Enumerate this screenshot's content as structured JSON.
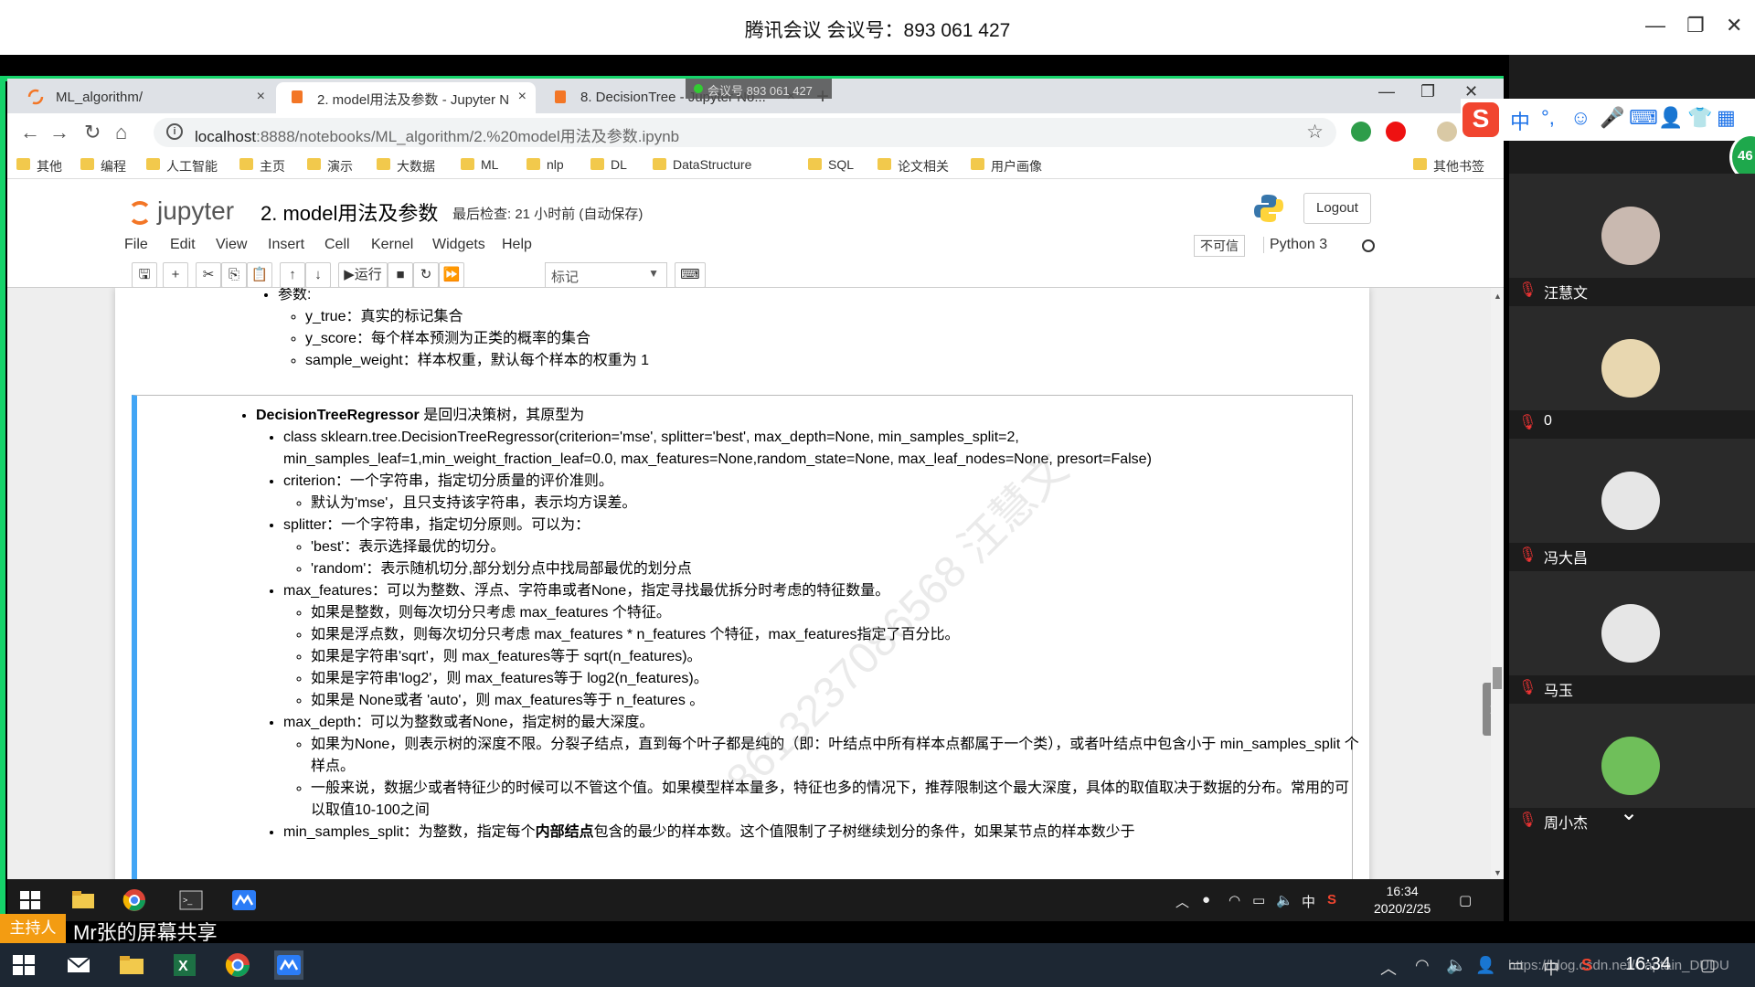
{
  "meeting": {
    "title": "腾讯会议 会议号：893 061 427",
    "badge": "会议号 893 061 427"
  },
  "browser": {
    "tabs": [
      {
        "label": "ML_algorithm/",
        "close": "×"
      },
      {
        "label": "2. model用法及参数 - Jupyter N",
        "close": "×"
      },
      {
        "label": "8. DecisionTree - Jupyter No...",
        "close": "×"
      }
    ],
    "new_tab": "+",
    "url_host": "localhost",
    "url_path": ":8888/notebooks/ML_algorithm/2.%20model用法及参数.ipynb",
    "bookmarks": [
      "其他",
      "编程",
      "人工智能",
      "主页",
      "演示",
      "大数据",
      "ML",
      "nlp",
      "DL",
      "DataStructure",
      "SQL",
      "论文相关",
      "用户画像"
    ],
    "other_bookmarks": "其他书签"
  },
  "jupyter": {
    "logo_text": "jupyter",
    "notebook_name": "2. model用法及参数",
    "checkpoint": "最后检查: 21 小时前   (自动保存)",
    "logout": "Logout",
    "menus": [
      "File",
      "Edit",
      "View",
      "Insert",
      "Cell",
      "Kernel",
      "Widgets",
      "Help"
    ],
    "trusted": "不可信",
    "kernel_name": "Python 3",
    "run_label": "运行",
    "cell_type": "标记"
  },
  "cell1": {
    "params_label": "参数:",
    "items": [
      "y_true：真实的标记集合",
      "y_score：每个样本预测为正类的概率的集合",
      "sample_weight：样本权重，默认每个样本的权重为 1"
    ]
  },
  "cell2": {
    "heading_bold": "DecisionTreeRegressor",
    "heading_rest": " 是回归决策树，其原型为",
    "signature_1": "class sklearn.tree.DecisionTreeRegressor(criterion='mse', splitter='best', max_depth=None, min_samples_split=2,",
    "signature_2": "min_samples_leaf=1,min_weight_fraction_leaf=0.0, max_features=None,random_state=None, max_leaf_nodes=None, presort=False)",
    "criterion": "criterion：一个字符串，指定切分质量的评价准则。",
    "criterion_sub": "默认为'mse'，且只支持该字符串，表示均方误差。",
    "splitter": "splitter：一个字符串，指定切分原则。可以为：",
    "splitter_sub": [
      "'best'：表示选择最优的切分。",
      "'random'：表示随机切分,部分划分点中找局部最优的划分点"
    ],
    "max_features": "max_features：可以为整数、浮点、字符串或者None，指定寻找最优拆分时考虑的特征数量。",
    "max_features_sub": [
      "如果是整数，则每次切分只考虑 max_features 个特征。",
      "如果是浮点数，则每次切分只考虑 max_features * n_features 个特征，max_features指定了百分比。",
      "如果是字符串'sqrt'，则 max_features等于 sqrt(n_features)。",
      "如果是字符串'log2'，则 max_features等于 log2(n_features)。",
      "如果是 None或者 'auto'，则 max_features等于 n_features 。"
    ],
    "max_depth": "max_depth：可以为整数或者None，指定树的最大深度。",
    "max_depth_sub": [
      "如果为None，则表示树的深度不限。分裂子结点，直到每个叶子都是纯的（即：叶结点中所有样本点都属于一个类），或者叶结点中包含小于 min_samples_split 个样点。",
      "一般来说，数据少或者特征少的时候可以不管这个值。如果模型样本量多，特征也多的情况下，推荐限制这个最大深度，具体的取值取决于数据的分布。常用的可以取值10-100之间"
    ],
    "min_samples_split_pre": "min_samples_split：为整数，指定每个",
    "min_samples_split_bold": "内部结点",
    "min_samples_split_post": "包含的最少的样本数。这个值限制了子树继续划分的条件，如果某节点的样本数少于"
  },
  "watermark": "8613237086568 汪慧文",
  "inner_taskbar": {
    "clock_time": "16:34",
    "clock_date": "2020/2/25",
    "ime": "中"
  },
  "ime_bar": {
    "sogou": "S",
    "lang": "中",
    "punct": "°,"
  },
  "badge_count": "46",
  "participants": [
    {
      "name": "汪慧文"
    },
    {
      "name": "0"
    },
    {
      "name": "冯大昌"
    },
    {
      "name": "马玉"
    },
    {
      "name": "周小杰"
    }
  ],
  "host": {
    "tag": "主持人",
    "text": "Mr张的屏幕共享"
  },
  "taskbar": {
    "clock": "16:34",
    "ime": "中",
    "overlay": "https://blog.csdn.net/Captain_DUDU"
  }
}
